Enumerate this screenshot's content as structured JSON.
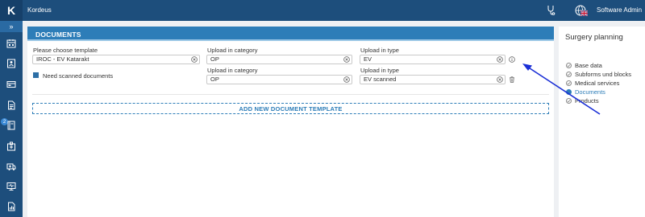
{
  "app": {
    "logo": "K",
    "name": "Kordeus",
    "user": "Software Admin"
  },
  "topbar_icons": [
    "stethoscope-icon",
    "globe-icon",
    "uk-flag-icon"
  ],
  "sidebar": {
    "expand_glyph": "»",
    "items": [
      "calendar-icon",
      "patient-icon",
      "card-icon",
      "document-icon",
      "book-icon",
      "hospital-icon",
      "ambulance-icon",
      "monitor-icon",
      "report-icon",
      "clipboard-icon",
      "form-icon"
    ],
    "badge": "2"
  },
  "documents": {
    "title": "DOCUMENTS",
    "template_label": "Please choose template",
    "template_value": "IROC - EV Katarakt",
    "need_scanned_label": "Need scanned documents",
    "need_scanned_checked": true,
    "rows": [
      {
        "category_label": "Upload in category",
        "category_value": "OP",
        "type_label": "Upload in type",
        "type_value": "EV",
        "action_icon": "info-icon"
      },
      {
        "category_label": "Upload in category",
        "category_value": "OP",
        "type_label": "Upload in type",
        "type_value": "EV scanned",
        "action_icon": "trash-icon"
      }
    ],
    "add_button": "ADD NEW DOCUMENT TEMPLATE"
  },
  "surgery_planning": {
    "title": "Surgery planning",
    "steps": [
      {
        "label": "Base data",
        "active": false
      },
      {
        "label": "Subforms und blocks",
        "active": false
      },
      {
        "label": "Medical services",
        "active": false
      },
      {
        "label": "Documents",
        "active": true
      },
      {
        "label": "Products",
        "active": false
      }
    ]
  },
  "colors": {
    "topbar": "#1d4e7c",
    "accent": "#2d7db8",
    "annotation_arrow": "#1a2fd6"
  }
}
